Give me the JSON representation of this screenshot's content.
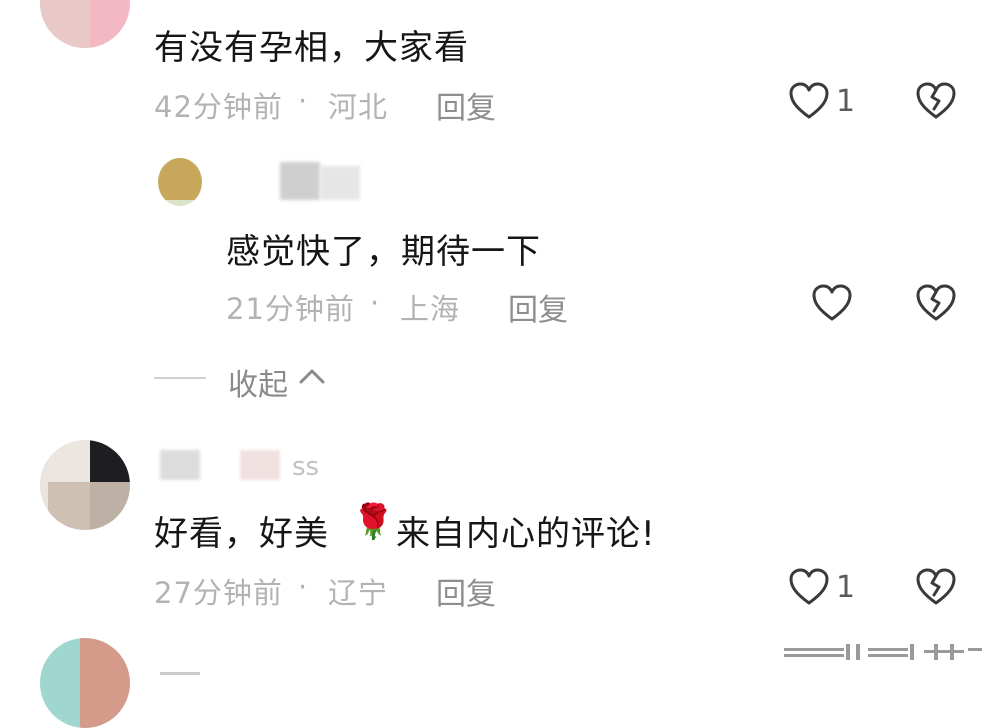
{
  "comments": [
    {
      "text": "有没有孕相，大家看",
      "time": "42分钟前",
      "separator": "·",
      "location": "河北",
      "reply_label": "回复",
      "like_count": "1"
    },
    {
      "text": "感觉快了，期待一下",
      "time": "21分钟前",
      "separator": "·",
      "location": "上海",
      "reply_label": "回复",
      "like_count": ""
    },
    {
      "username_suffix": "ss",
      "text_before": "好看，好美",
      "emoji": "🌹",
      "text_after": "来自内心的评论!",
      "time": "27分钟前",
      "separator": "·",
      "location": "辽宁",
      "reply_label": "回复",
      "like_count": "1"
    }
  ],
  "collapse_label": "收起",
  "icons": {
    "like": "heart-outline-icon",
    "dislike": "broken-heart-icon",
    "collapse": "chevron-up-icon"
  },
  "colors": {
    "text": "#161616",
    "meta": "#b3b3b3",
    "icon": "#3a3a3a"
  }
}
